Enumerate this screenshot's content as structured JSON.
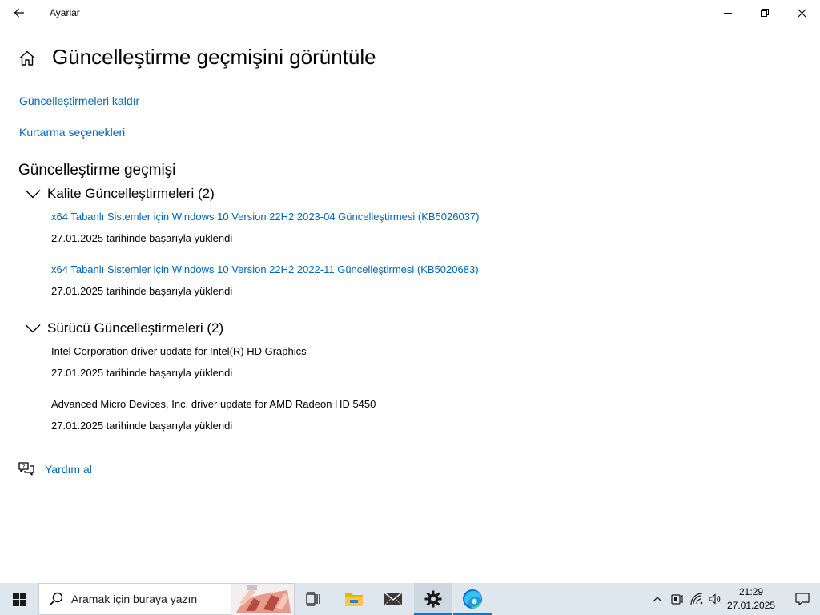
{
  "window": {
    "title": "Ayarlar"
  },
  "page": {
    "title": "Güncelleştirme geçmişini görüntüle",
    "links": {
      "uninstall": "Güncelleştirmeleri kaldır",
      "recovery": "Kurtarma seçenekleri"
    },
    "history_title": "Güncelleştirme geçmişi",
    "groups": [
      {
        "label": "Kalite Güncelleştirmeleri (2)",
        "items": [
          {
            "title": "x64 Tabanlı Sistemler için Windows 10 Version 22H2 2023-04 Güncelleştirmesi (KB5026037)",
            "status": "27.01.2025 tarihinde başarıyla yüklendi"
          },
          {
            "title": "x64 Tabanlı Sistemler için Windows 10 Version 22H2 2022-11 Güncelleştirmesi (KB5020683)",
            "status": "27.01.2025 tarihinde başarıyla yüklendi"
          }
        ]
      },
      {
        "label": "Sürücü Güncelleştirmeleri (2)",
        "items": [
          {
            "title": "Intel Corporation driver update for Intel(R) HD Graphics",
            "status": "27.01.2025 tarihinde başarıyla yüklendi"
          },
          {
            "title": "Advanced Micro Devices, Inc. driver update for AMD Radeon HD 5450",
            "status": "27.01.2025 tarihinde başarıyla yüklendi"
          }
        ]
      }
    ],
    "help_label": "Yardım al"
  },
  "taskbar": {
    "search_placeholder": "Aramak için buraya yazın",
    "time": "21:29",
    "date": "27.01.2025",
    "apps": [
      "task-view-icon",
      "file-explorer-icon",
      "mail-icon",
      "settings-icon",
      "edge-icon"
    ]
  },
  "colors": {
    "link": "#0067b8",
    "taskbar": "#dfe7ee",
    "accent": "#0078d4"
  }
}
